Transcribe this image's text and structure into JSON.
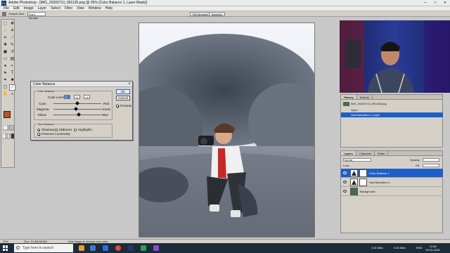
{
  "window": {
    "title": "Adobe Photoshop - [IMG_20200713_091135.png @ 25% (Color Balance 1, Layer Mask)]",
    "controls": [
      "—",
      "□",
      "✕"
    ]
  },
  "menu": [
    "File",
    "Edit",
    "Image",
    "Layer",
    "Select",
    "Filter",
    "View",
    "Window",
    "Help"
  ],
  "options_bar": {
    "sample_size_label": "Sample Size:",
    "sample_size_value": "Point Sample",
    "dock_tabs": [
      "File Browser",
      "Brushes"
    ]
  },
  "toolbox": {
    "tools": [
      "marquee-icon",
      "move-icon",
      "lasso-icon",
      "magic-wand-icon",
      "crop-icon",
      "slice-icon",
      "healing-icon",
      "brush-icon",
      "stamp-icon",
      "history-brush-icon",
      "eraser-icon",
      "gradient-icon",
      "blur-icon",
      "dodge-icon",
      "path-select-icon",
      "type-icon",
      "pen-icon",
      "shape-icon",
      "notes-icon",
      "eyedropper-icon",
      "hand-icon",
      "zoom-icon"
    ],
    "foreground_color": "#b9561b",
    "background_color": "#ffffff"
  },
  "color_balance": {
    "title": "Color Balance",
    "group_label": "Color Balance",
    "levels_label": "Color Levels:",
    "levels": [
      "0",
      "-6",
      "+5"
    ],
    "sliders": [
      {
        "left": "Cyan",
        "right": "Red",
        "value": 0
      },
      {
        "left": "Magenta",
        "right": "Green",
        "value": -6
      },
      {
        "left": "Yellow",
        "right": "Blue",
        "value": 5
      }
    ],
    "tone_group_label": "Tone Balance",
    "tones": [
      "Shadows",
      "Midtones",
      "Highlights"
    ],
    "selected_tone": "Shadows",
    "preserve_luminosity_label": "Preserve Luminosity",
    "preserve_luminosity": true,
    "ok_label": "OK",
    "cancel_label": "Cancel",
    "preview_label": "Preview",
    "preview": true
  },
  "history_panel": {
    "tabs": [
      "History",
      "Actions"
    ],
    "snapshot": "IMG_20200713_091135.png",
    "items": [
      "Open",
      "Hue/Saturation 1 Layer"
    ],
    "selected_index": 1
  },
  "layers_panel": {
    "tabs": [
      "Layers",
      "Channels",
      "Paths"
    ],
    "blend_mode": "Normal",
    "opacity_label": "Opacity:",
    "fill_label": "Fill:",
    "lock_label": "Lock:",
    "layers": [
      {
        "name": "Color Balance 1",
        "selected": true
      },
      {
        "name": "Hue/Saturation 1",
        "selected": false
      },
      {
        "name": "Background",
        "selected": false
      }
    ]
  },
  "status_bar": {
    "zoom": "25%",
    "doc": "Doc: 19.4M/39.6M",
    "hint": "Click image to choose new color"
  },
  "taskbar": {
    "search_placeholder": "Type here to search",
    "tray_left": "0.00 kB/s",
    "tray_right": "0.00 kB/s",
    "language": "ENG",
    "time": "11:38",
    "date": "04-01-2021"
  }
}
